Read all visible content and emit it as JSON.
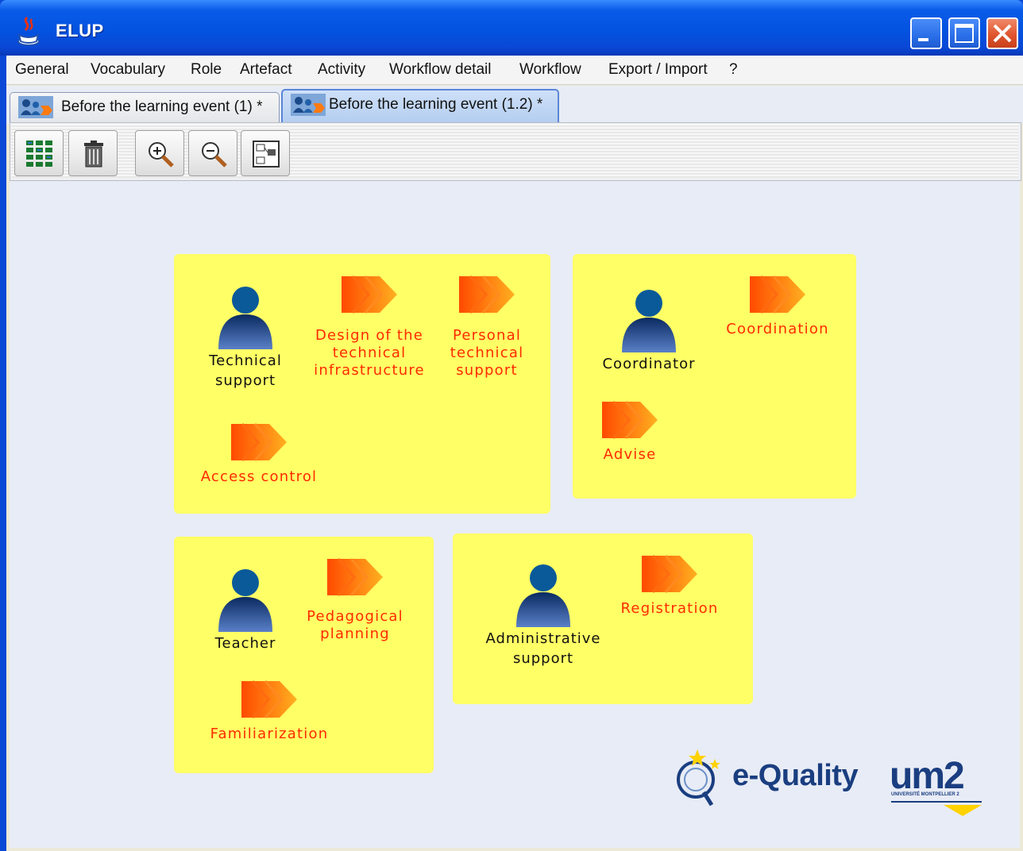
{
  "window": {
    "title": "ELUP",
    "app_icon": "java-cup-icon",
    "controls": [
      "minimize-icon",
      "maximize-icon",
      "close-icon"
    ]
  },
  "menu": {
    "items": [
      "General",
      "Vocabulary",
      "Role",
      "Artefact",
      "Activity",
      "Workflow detail",
      "Workflow",
      "Export / Import",
      "?"
    ]
  },
  "tabs": [
    {
      "label": "Before the learning event (1) *",
      "icon": "role-activity-icon",
      "active": false
    },
    {
      "label": "Before the learning event (1.2) *",
      "icon": "role-activity-icon",
      "active": true
    }
  ],
  "toolbar": {
    "buttons": [
      "grid-layout-icon",
      "trash-icon",
      "zoom-in-icon",
      "zoom-out-icon",
      "fit-diagram-icon"
    ]
  },
  "groups": [
    {
      "role": "Technical\nsupport",
      "activities": [
        "Design of the\ntechnical\ninfrastructure",
        "Personal\ntechnical\nsupport",
        "Access control"
      ]
    },
    {
      "role": "Coordinator",
      "activities": [
        "Coordination",
        "Advise"
      ]
    },
    {
      "role": "Teacher",
      "activities": [
        "Pedagogical\nplanning",
        "Familiarization"
      ]
    },
    {
      "role": "Administrative\nsupport",
      "activities": [
        "Registration"
      ]
    }
  ],
  "logos": {
    "equality": "e-Quality",
    "um2": "um2",
    "um2_subtitle": "UNIVERSITÉ MONTPELLIER 2"
  },
  "colors": {
    "group_fill": "#ffff66",
    "activity_text": "#ff2a00",
    "titlebar": "#0a48d6",
    "canvas": "#e8ecf6"
  }
}
